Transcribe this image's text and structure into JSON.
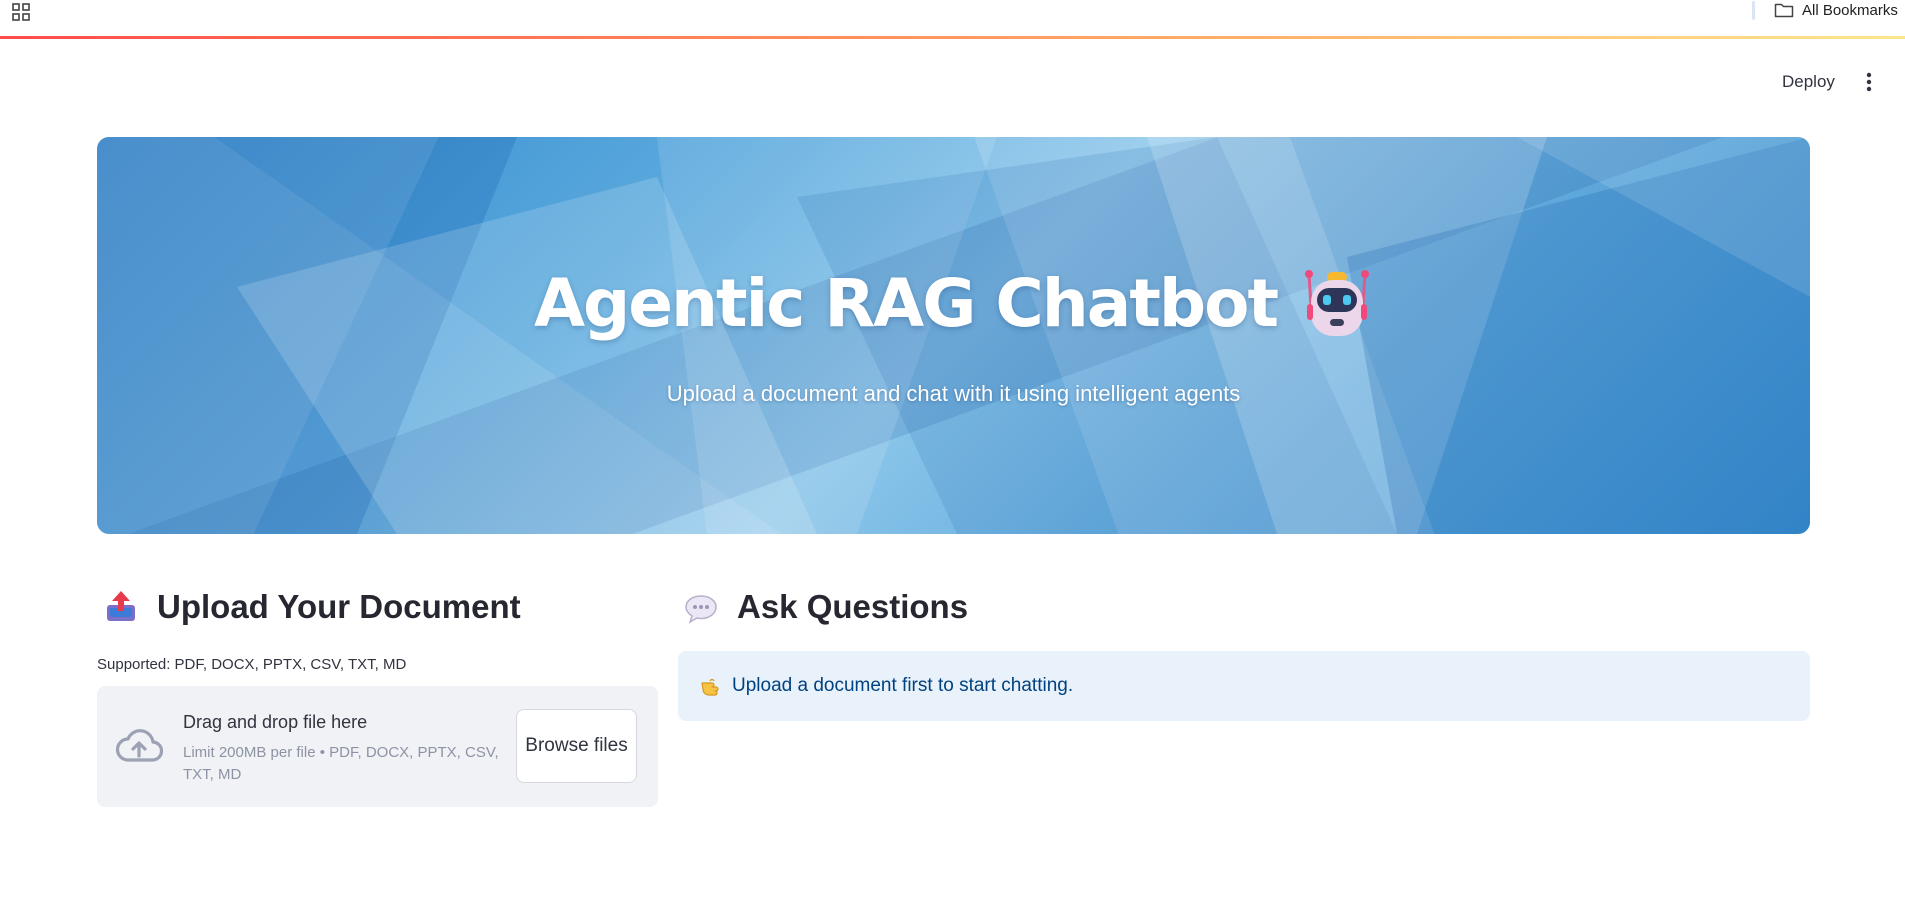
{
  "browser": {
    "bookmarks_label": "All Bookmarks"
  },
  "header": {
    "deploy_label": "Deploy",
    "menu_icon": "more-vertical-icon"
  },
  "hero": {
    "title": "Agentic RAG Chatbot",
    "title_icon": "robot-icon",
    "subtitle": "Upload a document and chat with it using intelligent agents"
  },
  "upload": {
    "heading": "Upload Your Document",
    "heading_icon": "outbox-tray-icon",
    "supported": "Supported: PDF, DOCX, PPTX, CSV, TXT, MD",
    "dropzone": {
      "title": "Drag and drop file here",
      "limit": "Limit 200MB per file • PDF, DOCX, PPTX, CSV, TXT, MD",
      "icon": "cloud-upload-icon",
      "button_label": "Browse files"
    }
  },
  "chat": {
    "heading": "Ask Questions",
    "heading_icon": "speech-balloon-icon",
    "info_icon": "pointing-hand-icon",
    "info_text": "Upload a document first to start chatting."
  },
  "colors": {
    "accent": "#ff4b4b",
    "info_bg": "#e9f2fb",
    "info_text": "#004280",
    "dropzone_bg": "#f0f2f6"
  }
}
